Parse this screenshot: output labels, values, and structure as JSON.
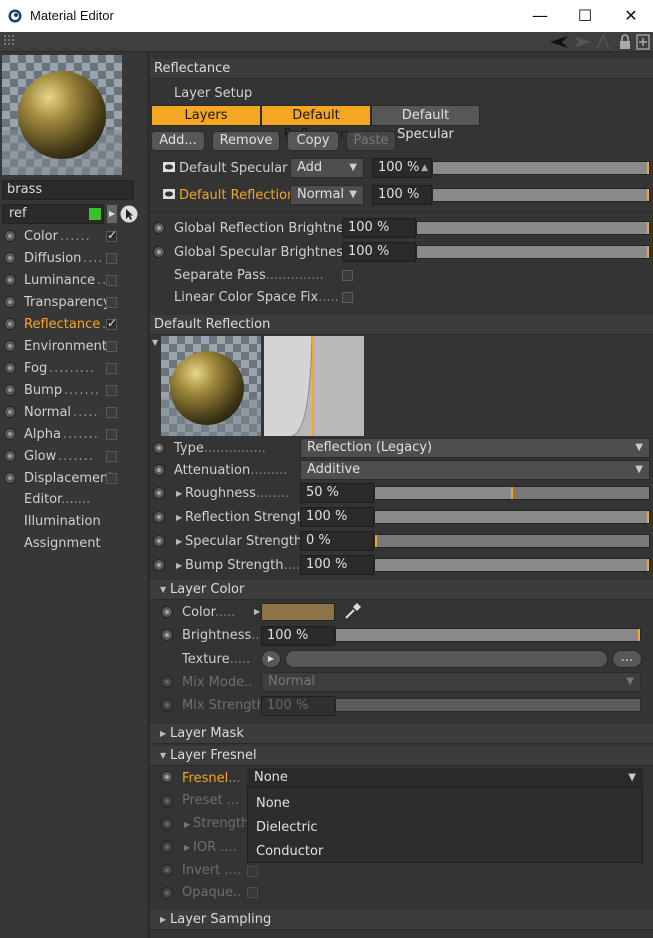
{
  "window": {
    "title": "Material Editor",
    "minimize": "—",
    "maximize": "☐",
    "close": "✕"
  },
  "material": {
    "name": "brass",
    "layer_name": "ref"
  },
  "channels": [
    {
      "label": "Color",
      "dots": "......",
      "checked": true,
      "active": false
    },
    {
      "label": "Diffusion",
      "dots": "....",
      "checked": false,
      "active": false
    },
    {
      "label": "Luminance",
      "dots": "..",
      "checked": false,
      "active": false
    },
    {
      "label": "Transparency",
      "dots": "",
      "checked": false,
      "active": false
    },
    {
      "label": "Reflectance",
      "dots": ".",
      "checked": true,
      "active": true
    },
    {
      "label": "Environment",
      "dots": "",
      "checked": false,
      "active": false
    },
    {
      "label": "Fog",
      "dots": ".........",
      "checked": false,
      "active": false
    },
    {
      "label": "Bump",
      "dots": ".......",
      "checked": false,
      "active": false
    },
    {
      "label": "Normal",
      "dots": ".....",
      "checked": false,
      "active": false
    },
    {
      "label": "Alpha",
      "dots": ".......",
      "checked": false,
      "active": false
    },
    {
      "label": "Glow",
      "dots": ".......",
      "checked": false,
      "active": false
    },
    {
      "label": "Displacement",
      "dots": "",
      "checked": false,
      "active": false
    }
  ],
  "extra_items": [
    "Editor",
    "Illumination",
    "Assignment"
  ],
  "editor_dots": ".......",
  "reflectance": {
    "header": "Reflectance",
    "layer_setup": "Layer Setup",
    "tabs": [
      "Layers",
      "Default Reflection",
      "Default Specular"
    ],
    "buttons": {
      "add": "Add...",
      "remove": "Remove",
      "copy": "Copy",
      "paste": "Paste"
    },
    "layers": [
      {
        "name": "Default Specular",
        "mode": "Add",
        "amount": "100 %",
        "level": 1.0
      },
      {
        "name": "Default Reflection",
        "mode": "Normal",
        "amount": "100 %",
        "level": 1.0
      }
    ],
    "global_reflection_brightness": {
      "label": "Global Reflection Brightness",
      "value": "100 %",
      "level": 1.0
    },
    "global_specular_brightness": {
      "label": "Global Specular Brightness",
      "value": "100 %",
      "level": 1.0
    },
    "separate_pass": "Separate Pass",
    "linear_color": "Linear Color Space Fix"
  },
  "default_reflection": {
    "header": "Default Reflection",
    "type_label": "Type",
    "type_value": "Reflection (Legacy)",
    "attenuation_label": "Attenuation",
    "attenuation_value": "Additive",
    "roughness": {
      "label": "Roughness",
      "value": "50 %",
      "level": 0.5
    },
    "reflection_strength": {
      "label": "Reflection Strength",
      "value": "100 %",
      "level": 1.0
    },
    "specular_strength": {
      "label": "Specular Strength",
      "value": "0 %",
      "level": 0.0
    },
    "bump_strength": {
      "label": "Bump Strength",
      "value": "100 %",
      "level": 1.0
    }
  },
  "layer_color": {
    "header": "Layer Color",
    "color_label": "Color",
    "swatch": "#8b7548",
    "brightness_label": "Brightness",
    "brightness_value": "100 %",
    "brightness_level": 1.0,
    "texture_label": "Texture",
    "texture_more": "...",
    "mix_mode_label": "Mix Mode",
    "mix_mode_value": "Normal",
    "mix_strength_label": "Mix Strength",
    "mix_strength_value": "100 %"
  },
  "layer_mask": {
    "header": "Layer Mask"
  },
  "layer_fresnel": {
    "header": "Layer Fresnel",
    "fresnel_label": "Fresnel",
    "fresnel_value": "None",
    "preset_label": "Preset",
    "strength_label": "Strength",
    "ior_label": "IOR",
    "invert_label": "Invert",
    "opaque_label": "Opaque",
    "options": [
      "None",
      "Dielectric",
      "Conductor"
    ]
  },
  "layer_sampling": {
    "header": "Layer Sampling"
  },
  "colors": {
    "accent": "#f5a623",
    "panel": "#343434",
    "active_green": "#39c12b"
  }
}
